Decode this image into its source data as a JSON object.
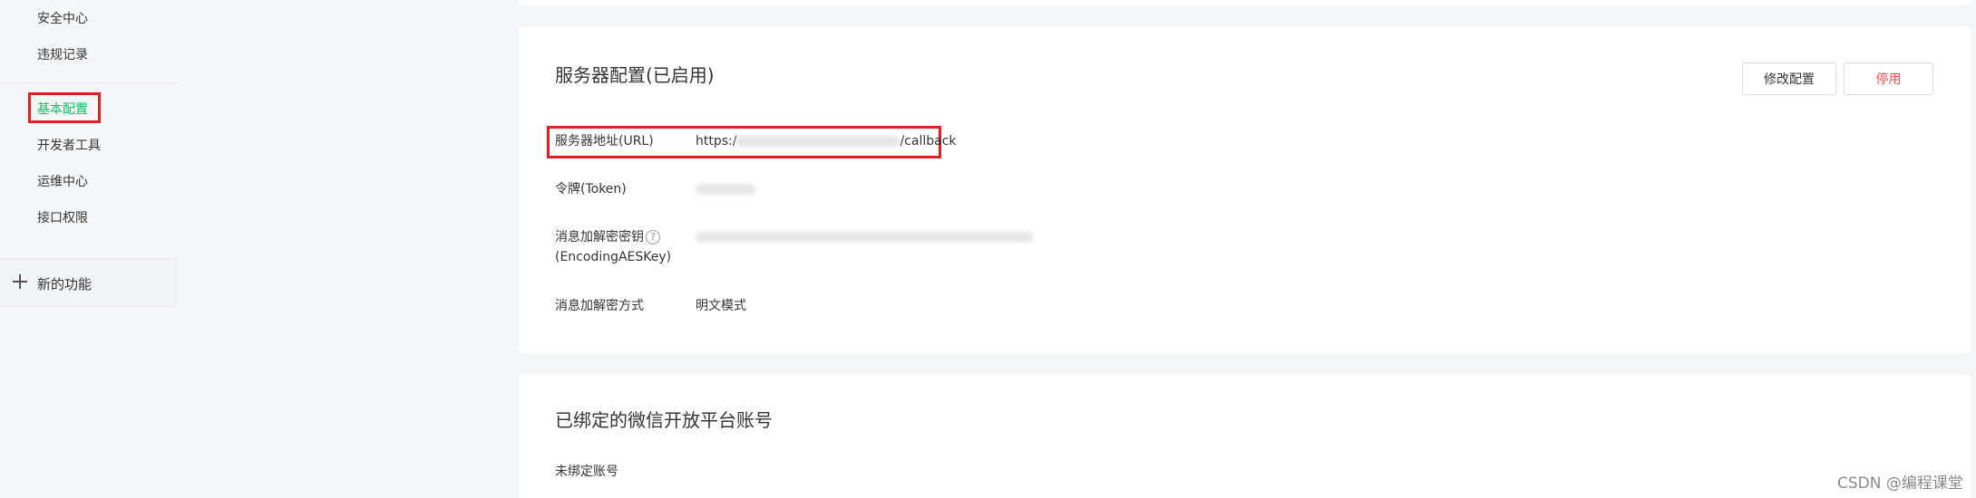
{
  "sidebar": {
    "items_top": [
      {
        "label": "安全中心"
      },
      {
        "label": "违规记录"
      }
    ],
    "items_mid": [
      {
        "label": "基本配置",
        "active": true
      },
      {
        "label": "开发者工具"
      },
      {
        "label": "运维中心"
      },
      {
        "label": "接口权限"
      }
    ],
    "new_features": {
      "icon": "plus-icon",
      "label": "新的功能"
    }
  },
  "server_config": {
    "title": "服务器配置(已启用)",
    "buttons": {
      "modify": "修改配置",
      "disable": "停用"
    },
    "url": {
      "label": "服务器地址(URL)",
      "value_prefix": "https:/",
      "value_suffix": "/callback"
    },
    "token": {
      "label": "令牌(Token)"
    },
    "aes_key": {
      "label_line1": "消息加解密密钥",
      "help_icon": "question-circle-icon",
      "label_line2": "(EncodingAESKey)"
    },
    "encrypt_mode": {
      "label": "消息加解密方式",
      "value": "明文模式"
    }
  },
  "bound_accounts": {
    "title": "已绑定的微信开放平台账号",
    "empty_text": "未绑定账号"
  },
  "watermark": "CSDN @编程课堂",
  "colors": {
    "active_green": "#07c160",
    "highlight_red": "#e02020",
    "danger_text": "#fa5151"
  }
}
